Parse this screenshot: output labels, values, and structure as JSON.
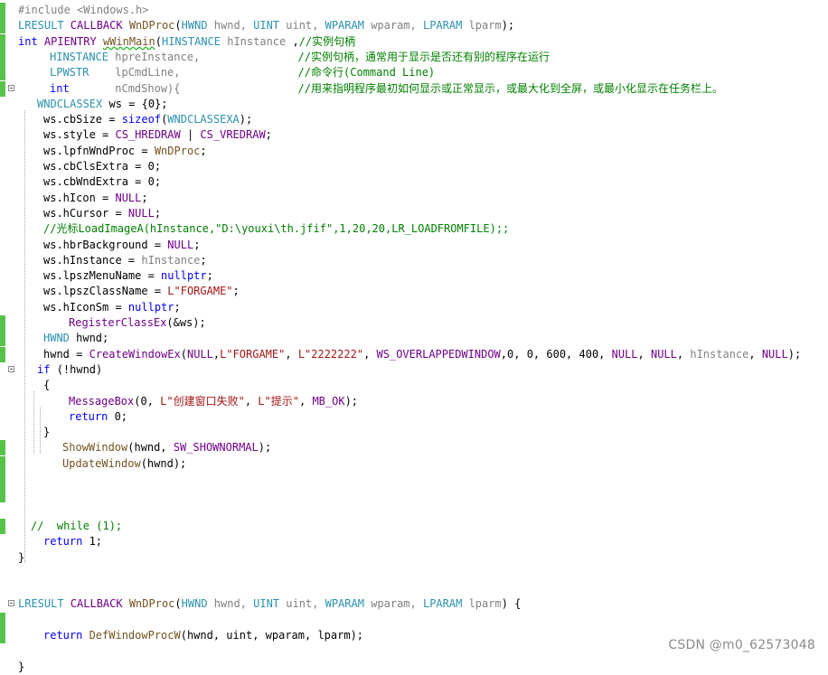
{
  "colors": {
    "change_bar": "#57c24a",
    "keyword": "#0000ff",
    "type": "#2b91af",
    "macro": "#6f008a",
    "string": "#a31515",
    "comment": "#008000",
    "function": "#74531f",
    "preprocessor": "#808080"
  },
  "watermark": "CSDN @m0_62573048",
  "lines": [
    {
      "tokens": [
        {
          "t": "#include <Windows.h>",
          "c": "pp"
        }
      ],
      "indent": 20,
      "gutter": "chg"
    },
    {
      "tokens": [
        {
          "t": "LRESULT ",
          "c": "ty"
        },
        {
          "t": "CALLBACK ",
          "c": "mac"
        },
        {
          "t": "WnDProc",
          "c": "fn"
        },
        {
          "t": "(",
          "c": "plain"
        },
        {
          "t": "HWND ",
          "c": "ty"
        },
        {
          "t": "hwnd, ",
          "c": "prm"
        },
        {
          "t": "UINT ",
          "c": "ty"
        },
        {
          "t": "uint, ",
          "c": "prm"
        },
        {
          "t": "WPARAM ",
          "c": "ty"
        },
        {
          "t": "wparam, ",
          "c": "prm"
        },
        {
          "t": "LPARAM ",
          "c": "ty"
        },
        {
          "t": "lparm",
          "c": "prm"
        },
        {
          "t": ");",
          "c": "plain"
        }
      ],
      "indent": 20,
      "gutter": "chg"
    },
    {
      "tokens": [
        {
          "t": "int ",
          "c": "kw"
        },
        {
          "t": "APIENTRY ",
          "c": "mac"
        },
        {
          "t": "wWinMain",
          "c": "fn",
          "err": true
        },
        {
          "t": "(",
          "c": "plain"
        },
        {
          "t": "HINSTANCE ",
          "c": "ty"
        },
        {
          "t": "hInstance ",
          "c": "prm"
        },
        {
          "t": ",",
          "c": "plain"
        },
        {
          "t": "//实例句柄",
          "c": "cm"
        }
      ],
      "indent": 20,
      "gutter": "chg"
    },
    {
      "tokens": [
        {
          "t": "HINSTANCE ",
          "c": "ty"
        },
        {
          "t": "hpreInstance,",
          "c": "prm"
        },
        {
          "t": "               //实例句柄，通常用于显示是否还有别的程序在运行",
          "c": "cm"
        }
      ],
      "indent": 55,
      "gutter": "chg"
    },
    {
      "tokens": [
        {
          "t": "LPWSTR    ",
          "c": "ty"
        },
        {
          "t": "lpCmdLine,",
          "c": "prm"
        },
        {
          "t": "                  //命令行(Command Line)",
          "c": "cm"
        }
      ],
      "indent": 55,
      "gutter": "chg"
    },
    {
      "tokens": [
        {
          "t": "int       ",
          "c": "kw"
        },
        {
          "t": "nCmdShow){",
          "c": "prm"
        },
        {
          "t": "                  //用来指明程序最初如何显示或正常显示，或最大化到全屏，或最小化显示在任务栏上。",
          "c": "cm"
        }
      ],
      "indent": 55,
      "gutter": "chg",
      "fold": true
    },
    {
      "tokens": [
        {
          "t": "WNDCLASSEX ",
          "c": "ty"
        },
        {
          "t": "ws = {0};",
          "c": "plain"
        }
      ],
      "indent": 41,
      "gutter": "clr"
    },
    {
      "tokens": [
        {
          "t": "ws.cbSize = ",
          "c": "plain"
        },
        {
          "t": "sizeof",
          "c": "kw"
        },
        {
          "t": "(",
          "c": "plain"
        },
        {
          "t": "WNDCLASSEXA",
          "c": "ty"
        },
        {
          "t": ");",
          "c": "plain"
        }
      ],
      "indent": 48,
      "gutter": "clr"
    },
    {
      "tokens": [
        {
          "t": "ws.style = ",
          "c": "plain"
        },
        {
          "t": "CS_HREDRAW ",
          "c": "mac"
        },
        {
          "t": "| ",
          "c": "plain"
        },
        {
          "t": "CS_VREDRAW",
          "c": "mac"
        },
        {
          "t": ";",
          "c": "plain"
        }
      ],
      "indent": 48,
      "gutter": "clr"
    },
    {
      "tokens": [
        {
          "t": "ws.lpfnWndProc = ",
          "c": "plain"
        },
        {
          "t": "WnDProc",
          "c": "fn"
        },
        {
          "t": ";",
          "c": "plain"
        }
      ],
      "indent": 48,
      "gutter": "clr"
    },
    {
      "tokens": [
        {
          "t": "ws.cbClsExtra = 0;",
          "c": "plain"
        }
      ],
      "indent": 48,
      "gutter": "clr"
    },
    {
      "tokens": [
        {
          "t": "ws.cbWndExtra = 0;",
          "c": "plain"
        }
      ],
      "indent": 48,
      "gutter": "clr"
    },
    {
      "tokens": [
        {
          "t": "ws.hIcon = ",
          "c": "plain"
        },
        {
          "t": "NULL",
          "c": "mac"
        },
        {
          "t": ";",
          "c": "plain"
        }
      ],
      "indent": 48,
      "gutter": "clr"
    },
    {
      "tokens": [
        {
          "t": "ws.hCursor = ",
          "c": "plain"
        },
        {
          "t": "NULL",
          "c": "mac"
        },
        {
          "t": ";",
          "c": "plain"
        }
      ],
      "indent": 48,
      "gutter": "clr"
    },
    {
      "tokens": [
        {
          "t": "//光标LoadImageA(hInstance,\"D:\\youxi\\th.jfif\",1,20,20,LR_LOADFROMFILE);;",
          "c": "cm"
        }
      ],
      "indent": 48,
      "gutter": "clr"
    },
    {
      "tokens": [
        {
          "t": "ws.hbrBackground = ",
          "c": "plain"
        },
        {
          "t": "NULL",
          "c": "mac"
        },
        {
          "t": ";",
          "c": "plain"
        }
      ],
      "indent": 48,
      "gutter": "clr"
    },
    {
      "tokens": [
        {
          "t": "ws.hInstance = ",
          "c": "plain"
        },
        {
          "t": "hInstance",
          "c": "prm"
        },
        {
          "t": ";",
          "c": "plain"
        }
      ],
      "indent": 48,
      "gutter": "clr"
    },
    {
      "tokens": [
        {
          "t": "ws.lpszMenuName = ",
          "c": "plain"
        },
        {
          "t": "nullptr",
          "c": "kw"
        },
        {
          "t": ";",
          "c": "plain"
        }
      ],
      "indent": 48,
      "gutter": "clr"
    },
    {
      "tokens": [
        {
          "t": "ws.lpszClassName = ",
          "c": "plain"
        },
        {
          "t": "L\"FORGAME\"",
          "c": "str"
        },
        {
          "t": ";",
          "c": "plain"
        }
      ],
      "indent": 48,
      "gutter": "clr"
    },
    {
      "tokens": [
        {
          "t": "ws.hIconSm = ",
          "c": "plain"
        },
        {
          "t": "nullptr",
          "c": "kw"
        },
        {
          "t": ";",
          "c": "plain"
        }
      ],
      "indent": 48,
      "gutter": "clr"
    },
    {
      "tokens": [
        {
          "t": "RegisterClassEx",
          "c": "mac"
        },
        {
          "t": "(&ws);",
          "c": "plain"
        }
      ],
      "indent": 76,
      "gutter": "chg"
    },
    {
      "tokens": [
        {
          "t": "HWND ",
          "c": "ty"
        },
        {
          "t": "hwnd;",
          "c": "plain"
        }
      ],
      "indent": 48,
      "gutter": "chg"
    },
    {
      "tokens": [
        {
          "t": "hwnd = ",
          "c": "plain"
        },
        {
          "t": "CreateWindowEx",
          "c": "mac"
        },
        {
          "t": "(",
          "c": "plain"
        },
        {
          "t": "NULL",
          "c": "mac"
        },
        {
          "t": ",",
          "c": "plain"
        },
        {
          "t": "L\"FORGAME\"",
          "c": "str"
        },
        {
          "t": ", ",
          "c": "plain"
        },
        {
          "t": "L\"2222222\"",
          "c": "str"
        },
        {
          "t": ", ",
          "c": "plain"
        },
        {
          "t": "WS_OVERLAPPEDWINDOW",
          "c": "mac"
        },
        {
          "t": ",0, 0, 600, 400, ",
          "c": "plain"
        },
        {
          "t": "NULL",
          "c": "mac"
        },
        {
          "t": ", ",
          "c": "plain"
        },
        {
          "t": "NULL",
          "c": "mac"
        },
        {
          "t": ", ",
          "c": "plain"
        },
        {
          "t": "hInstance",
          "c": "prm"
        },
        {
          "t": ", ",
          "c": "plain"
        },
        {
          "t": "NULL",
          "c": "mac"
        },
        {
          "t": ");",
          "c": "plain"
        }
      ],
      "indent": 48,
      "gutter": "chg"
    },
    {
      "tokens": [
        {
          "t": "if ",
          "c": "kw"
        },
        {
          "t": "(!hwnd)",
          "c": "plain"
        }
      ],
      "indent": 41,
      "gutter": "clr",
      "fold": true
    },
    {
      "tokens": [
        {
          "t": "{",
          "c": "plain"
        }
      ],
      "indent": 48,
      "gutter": "clr"
    },
    {
      "tokens": [
        {
          "t": "MessageBox",
          "c": "mac"
        },
        {
          "t": "(0, ",
          "c": "plain"
        },
        {
          "t": "L\"创建窗口失败\"",
          "c": "str"
        },
        {
          "t": ", ",
          "c": "plain"
        },
        {
          "t": "L\"提示\"",
          "c": "str"
        },
        {
          "t": ", ",
          "c": "plain"
        },
        {
          "t": "MB_OK",
          "c": "mac"
        },
        {
          "t": ");",
          "c": "plain"
        }
      ],
      "indent": 76,
      "gutter": "clr"
    },
    {
      "tokens": [
        {
          "t": "return ",
          "c": "kw"
        },
        {
          "t": "0;",
          "c": "plain"
        }
      ],
      "indent": 76,
      "gutter": "clr"
    },
    {
      "tokens": [
        {
          "t": "}",
          "c": "plain"
        }
      ],
      "indent": 48,
      "gutter": "clr"
    },
    {
      "tokens": [
        {
          "t": "ShowWindow",
          "c": "fn"
        },
        {
          "t": "(hwnd, ",
          "c": "plain"
        },
        {
          "t": "SW_SHOWNORMAL",
          "c": "mac"
        },
        {
          "t": ");",
          "c": "plain"
        }
      ],
      "indent": 69,
      "gutter": "chg"
    },
    {
      "tokens": [
        {
          "t": "UpdateWindow",
          "c": "fn"
        },
        {
          "t": "(hwnd);",
          "c": "plain"
        }
      ],
      "indent": 69,
      "gutter": "chg"
    },
    {
      "tokens": [],
      "indent": 20,
      "gutter": "chg"
    },
    {
      "tokens": [],
      "indent": 20,
      "gutter": "chg"
    },
    {
      "tokens": [],
      "indent": 20,
      "gutter": "clr"
    },
    {
      "tokens": [
        {
          "t": "//  while (1);",
          "c": "cm"
        }
      ],
      "indent": 34,
      "gutter": "chg"
    },
    {
      "tokens": [
        {
          "t": "return ",
          "c": "kw"
        },
        {
          "t": "1;",
          "c": "plain"
        }
      ],
      "indent": 48,
      "gutter": "clr"
    },
    {
      "tokens": [
        {
          "t": "}",
          "c": "plain"
        }
      ],
      "indent": 20,
      "gutter": "clr"
    },
    {
      "tokens": [],
      "indent": 20,
      "gutter": "clr"
    },
    {
      "tokens": [],
      "indent": 20,
      "gutter": "clr"
    },
    {
      "tokens": [
        {
          "t": "LRESULT ",
          "c": "ty"
        },
        {
          "t": "CALLBACK ",
          "c": "mac"
        },
        {
          "t": "WnDProc",
          "c": "fn"
        },
        {
          "t": "(",
          "c": "plain"
        },
        {
          "t": "HWND ",
          "c": "ty"
        },
        {
          "t": "hwnd, ",
          "c": "prm"
        },
        {
          "t": "UINT ",
          "c": "ty"
        },
        {
          "t": "uint, ",
          "c": "prm"
        },
        {
          "t": "WPARAM ",
          "c": "ty"
        },
        {
          "t": "wparam, ",
          "c": "prm"
        },
        {
          "t": "LPARAM ",
          "c": "ty"
        },
        {
          "t": "lparm",
          "c": "prm"
        },
        {
          "t": ") {",
          "c": "plain"
        }
      ],
      "indent": 20,
      "gutter": "clr",
      "fold": true
    },
    {
      "tokens": [],
      "indent": 20,
      "gutter": "chg"
    },
    {
      "tokens": [
        {
          "t": "return ",
          "c": "kw"
        },
        {
          "t": "DefWindowProcW",
          "c": "fn"
        },
        {
          "t": "(hwnd, uint, wparam, lparm);",
          "c": "plain"
        }
      ],
      "indent": 48,
      "gutter": "chg"
    },
    {
      "tokens": [],
      "indent": 20,
      "gutter": "clr"
    },
    {
      "tokens": [
        {
          "t": "}",
          "c": "plain"
        }
      ],
      "indent": 20,
      "gutter": "clr"
    }
  ]
}
